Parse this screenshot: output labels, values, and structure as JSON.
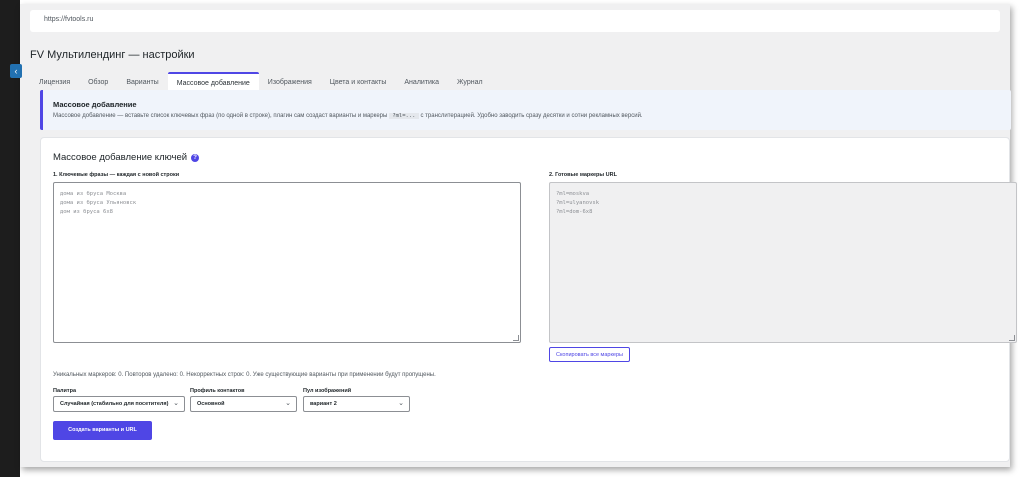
{
  "browser": {
    "url": "https://fvtools.ru"
  },
  "page": {
    "title": "FV Мультилендинг — настройки"
  },
  "tabs": [
    {
      "label": "Лицензия",
      "active": false
    },
    {
      "label": "Обзор",
      "active": false
    },
    {
      "label": "Варианты",
      "active": false
    },
    {
      "label": "Массовое добавление",
      "active": true
    },
    {
      "label": "Изображения",
      "active": false
    },
    {
      "label": "Цвета и контакты",
      "active": false
    },
    {
      "label": "Аналитика",
      "active": false
    },
    {
      "label": "Журнал",
      "active": false
    }
  ],
  "notice": {
    "title": "Массовое добавление",
    "text_before": "Массовое добавление — вставьте список ключевых фраз (по одной в строке), плагин сам создаст варианты и маркеры",
    "code": "?ml=...",
    "text_after": "с транслитерацией. Удобно заводить сразу десятки и сотни рекламных версий."
  },
  "card": {
    "title": "Массовое добавление ключей",
    "help_icon": "?",
    "phrases_label": "1. Ключевые фразы — каждая с новой строки",
    "phrases": [
      "дома из бруса Москва",
      "дома из бруса Ульяновск",
      "дом из бруса 6x8"
    ],
    "markers_label": "2. Готовые маркеры URL",
    "markers": [
      "?ml=moskva",
      "?ml=ulyanovsk",
      "?ml=dom-6x8"
    ],
    "copy_button": "Скопировать все маркеры",
    "stats": "Уникальных маркеров: 0. Повторов удалено: 0. Некорректных строк: 0. Уже существующие варианты при применении будут пропущены.",
    "palette_label": "Палитра",
    "palette_value": "Случайная (стабильно для посетителя)",
    "contacts_label": "Профиль контактов",
    "contacts_value": "Основной",
    "images_label": "Пул изображений",
    "images_value": "вариант 2",
    "submit_button": "Создать варианты и URL"
  },
  "colors": {
    "accent": "#4f46e5",
    "notice_bg": "#f0f4fb"
  }
}
